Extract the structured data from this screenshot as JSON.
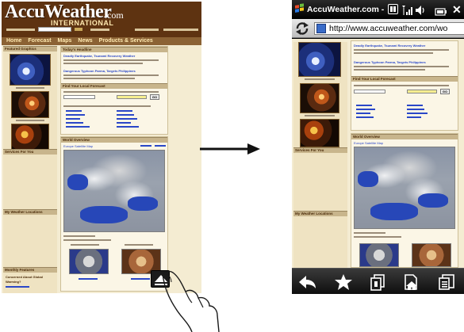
{
  "left_page": {
    "logo": "AccuWeather",
    "logo_suffix": ".com",
    "logo_sub": "INTERNATIONAL",
    "nav_items": [
      "Home",
      "Forecast",
      "Maps",
      "News",
      "Products & Services"
    ],
    "left_sections": [
      "Featured Graphics",
      "Services For You",
      "My Weather Locations",
      "Monthly Features"
    ],
    "headline_heading": "Today's Headline",
    "headline_link_1": "Deadly Earthquake, Tsunami Recovery Weather",
    "headline_link_2": "Dangerous Typhoon Parma, Targets Philippines",
    "forecast_heading": "Find Your Local Forecast",
    "go_label": "GO",
    "overview_heading": "World Overview",
    "overview_link": "Europe Satellite Map",
    "monthly_text_1": "Concerned About Global",
    "monthly_text_2": "Warming?"
  },
  "phone": {
    "title": "AccuWeather.com -",
    "url": "http://www.accuweather.com/wo",
    "toolbar_icons": [
      "back-icon",
      "favorites-star-icon",
      "tabs-icon",
      "home-page-icon",
      "menu-icon"
    ]
  },
  "colors": {
    "brand_brown": "#5e3311",
    "nav_brown": "#8b6234",
    "page_bg": "#f4ecd2",
    "link_blue": "#2a47c8"
  }
}
